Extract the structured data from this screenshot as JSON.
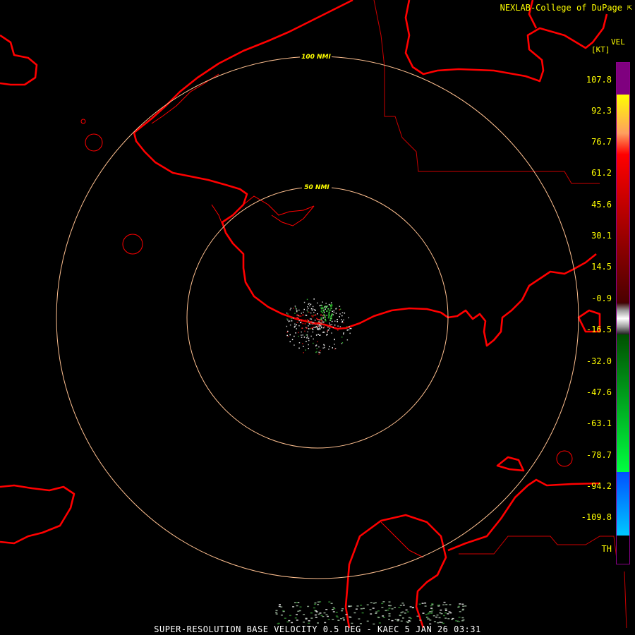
{
  "header": {
    "credit": "NEXLAB-College of DuPage",
    "credit_icon": "corner-arrow-icon"
  },
  "legend": {
    "product": "VEL",
    "unit": "[KT]",
    "ticks": [
      "107.8",
      "92.3",
      "76.7",
      "61.2",
      "45.6",
      "30.1",
      "14.5",
      "-0.9",
      "-16.5",
      "-32.0",
      "-47.6",
      "-63.1",
      "-78.7",
      "-94.2",
      "-109.8",
      "TH"
    ],
    "colors": {
      "purple": "#7f007f",
      "yellow": "#ffff00",
      "orange": "#ff9f5f",
      "red": "#ff0000",
      "dark_red": "#4a0000",
      "gray": "#a0a0a0",
      "dark_green": "#004f00",
      "green": "#00ff40",
      "blue": "#0050ff",
      "cyan": "#00c8ff",
      "black": "#000000"
    }
  },
  "rings": [
    {
      "label": "100 NMI"
    },
    {
      "label": "50 NMI"
    }
  ],
  "map": {
    "coastline_color": "#ff0000",
    "ring_color": "#ffc090",
    "boundary_color": "#cc0000"
  },
  "footer": {
    "caption": "SUPER-RESOLUTION BASE VELOCITY 0.5 DEG - KAEC 5 JAN 26 03:31"
  }
}
